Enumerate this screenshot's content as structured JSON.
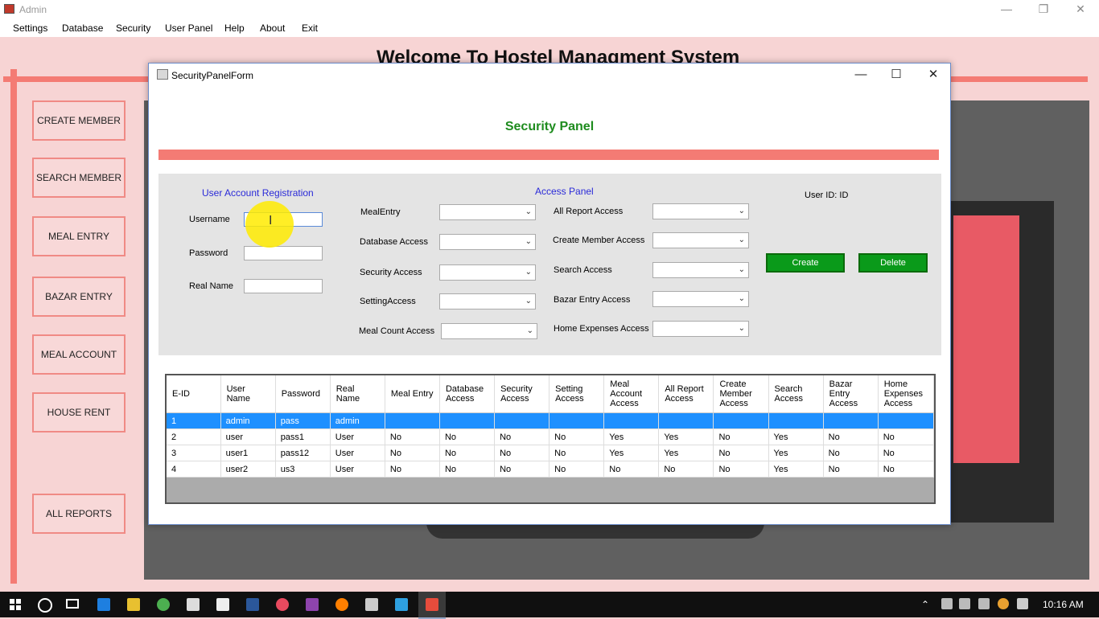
{
  "main_window": {
    "title": "Admin",
    "menu": [
      "Settings",
      "Database",
      "Security",
      "User Panel",
      "Help",
      "About",
      "Exit"
    ],
    "welcome": "Welcome To Hostel Managment System",
    "sidebar": [
      "CREATE MEMBER",
      "SEARCH MEMBER",
      "MEAL ENTRY",
      "BAZAR ENTRY",
      "MEAL ACCOUNT",
      "HOUSE RENT",
      "ALL REPORTS"
    ],
    "controls": {
      "minimize": "—",
      "restore": "❐",
      "close": "✕"
    }
  },
  "dialog": {
    "title": "SecurityPanelForm",
    "controls": {
      "minimize": "—",
      "maximize": "☐",
      "close": "✕"
    },
    "heading": "Security Panel",
    "registration": {
      "title": "User Account Registration",
      "username_label": "Username",
      "password_label": "Password",
      "realname_label": "Real Name"
    },
    "access": {
      "title": "Access Panel",
      "left": [
        "MealEntry",
        "Database Access",
        "Security Access",
        "SettingAccess",
        "Meal Count Access"
      ],
      "right": [
        "All Report Access",
        "Create Member Access",
        "Search Access",
        "Bazar Entry Access",
        "Home Expenses Access"
      ]
    },
    "user_id_label": "User ID: ID",
    "create_button": "Create",
    "delete_button": "Delete",
    "grid": {
      "columns": [
        "E-ID",
        "User Name",
        "Password",
        "Real Name",
        "Meal Entry",
        "Database Access",
        "Security Access",
        "Setting Access",
        "Meal Account Access",
        "All Report Access",
        "Create Member Access",
        "Search Access",
        "Bazar Entry Access",
        "Home Expenses Access"
      ],
      "rows": [
        [
          "1",
          "admin",
          "pass",
          "admin",
          "",
          "",
          "",
          "",
          "",
          "",
          "",
          "",
          "",
          ""
        ],
        [
          "2",
          "user",
          "pass1",
          "User",
          "No",
          "No",
          "No",
          "No",
          "Yes",
          "Yes",
          "No",
          "Yes",
          "No",
          "No"
        ],
        [
          "3",
          "user1",
          "pass12",
          "User",
          "No",
          "No",
          "No",
          "No",
          "Yes",
          "Yes",
          "No",
          "Yes",
          "No",
          "No"
        ],
        [
          "4",
          "user2",
          "us3",
          "User",
          "No",
          "No",
          "No",
          "No",
          "No",
          "No",
          "No",
          "Yes",
          "No",
          "No"
        ]
      ],
      "selected_row": 0
    }
  },
  "taskbar": {
    "clock": "10:16 AM"
  },
  "colors": {
    "accent_red": "#f47b74",
    "heading_green": "#1e8c1e",
    "button_green": "#0a9a1a",
    "selection_blue": "#1e90ff",
    "label_blue": "#2a2ad8"
  }
}
